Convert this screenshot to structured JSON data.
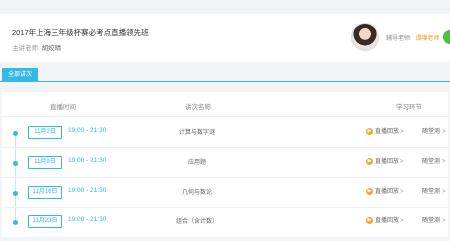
{
  "course": {
    "title": "2017年上海三年级杯赛必考点直播领先班",
    "teacher_label": "主讲老师:",
    "teacher_name": "胡姣晴"
  },
  "tutor": {
    "label": "辅导老师:",
    "name": "谭噗老师"
  },
  "tabs": [
    "全部讲次"
  ],
  "table": {
    "headers": [
      "直播时间",
      "讲次名称",
      "学习环节"
    ],
    "rows": [
      {
        "date": "11月2日",
        "time": "19:00 - 21:30",
        "name": "计算与数字谜",
        "replay": "直播回放",
        "test": "随堂测"
      },
      {
        "date": "11月9日",
        "time": "19:00 - 21:30",
        "name": "应用题",
        "replay": "直播回放",
        "test": "随堂测"
      },
      {
        "date": "11月16日",
        "time": "19:00 - 21:30",
        "name": "几何与数论",
        "replay": "直播回放",
        "test": "随堂测"
      },
      {
        "date": "11月23日",
        "time": "19:00 - 21:30",
        "name": "组合（含计数）",
        "replay": "直播回放",
        "test": "随堂测"
      }
    ]
  },
  "icons": {
    "replay": "play-circle-icon",
    "arrow": "chevron-right-icon"
  },
  "colors": {
    "accent": "#35b8e5",
    "replay_icon": "#f0a830",
    "tutor_name": "#e89a2b"
  }
}
